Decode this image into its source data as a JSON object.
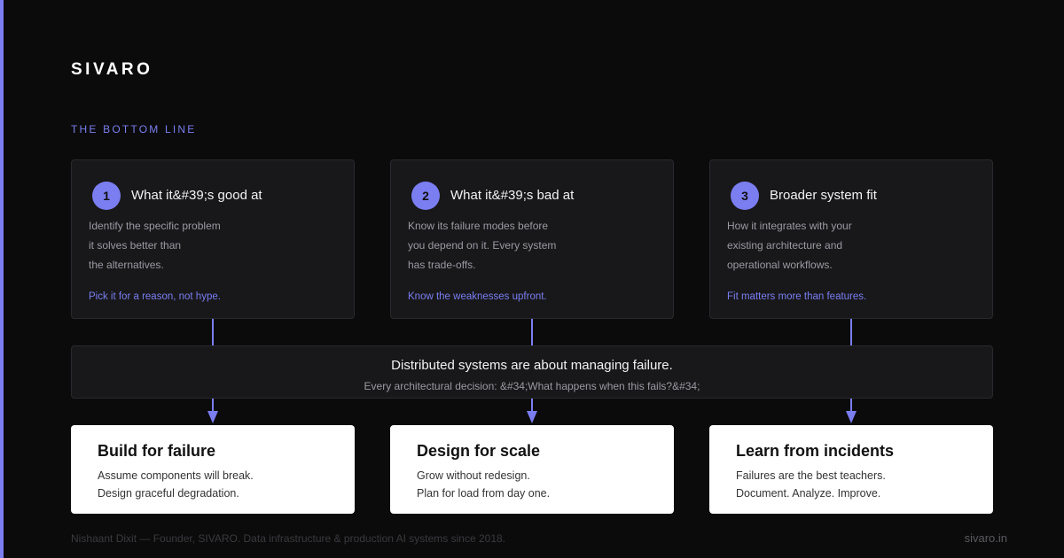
{
  "brand": "SIVARO",
  "eyebrow": "THE BOTTOM LINE",
  "cards": [
    {
      "num": "1",
      "title": "What it&#39;s good at",
      "desc": [
        "Identify the specific problem",
        "it solves better than",
        "the alternatives."
      ],
      "note": "Pick it for a reason, not hype."
    },
    {
      "num": "2",
      "title": "What it&#39;s bad at",
      "desc": [
        "Know its failure modes before",
        "you depend on it. Every system",
        "has trade-offs."
      ],
      "note": "Know the weaknesses upfront."
    },
    {
      "num": "3",
      "title": "Broader system fit",
      "desc": [
        "How it integrates with your",
        "existing architecture and",
        "operational workflows."
      ],
      "note": "Fit matters more than features."
    }
  ],
  "center": {
    "headline": "Distributed systems are about managing failure.",
    "sub": "Every architectural decision: &#34;What happens when this fails?&#34;"
  },
  "outcomes": [
    {
      "title": "Build for failure",
      "lines": [
        "Assume components will break.",
        "Design graceful degradation."
      ]
    },
    {
      "title": "Design for scale",
      "lines": [
        "Grow without redesign.",
        "Plan for load from day one."
      ]
    },
    {
      "title": "Learn from incidents",
      "lines": [
        "Failures are the best teachers.",
        "Document. Analyze. Improve."
      ]
    }
  ],
  "footer": {
    "left": "Nishaant Dixit — Founder, SIVARO. Data infrastructure & production AI systems since 2018.",
    "right": "sivaro.in"
  },
  "colors": {
    "accent": "#7b7ef0",
    "background": "#0b0b0b",
    "card": "#18181b",
    "outcome_card": "#ffffff"
  }
}
